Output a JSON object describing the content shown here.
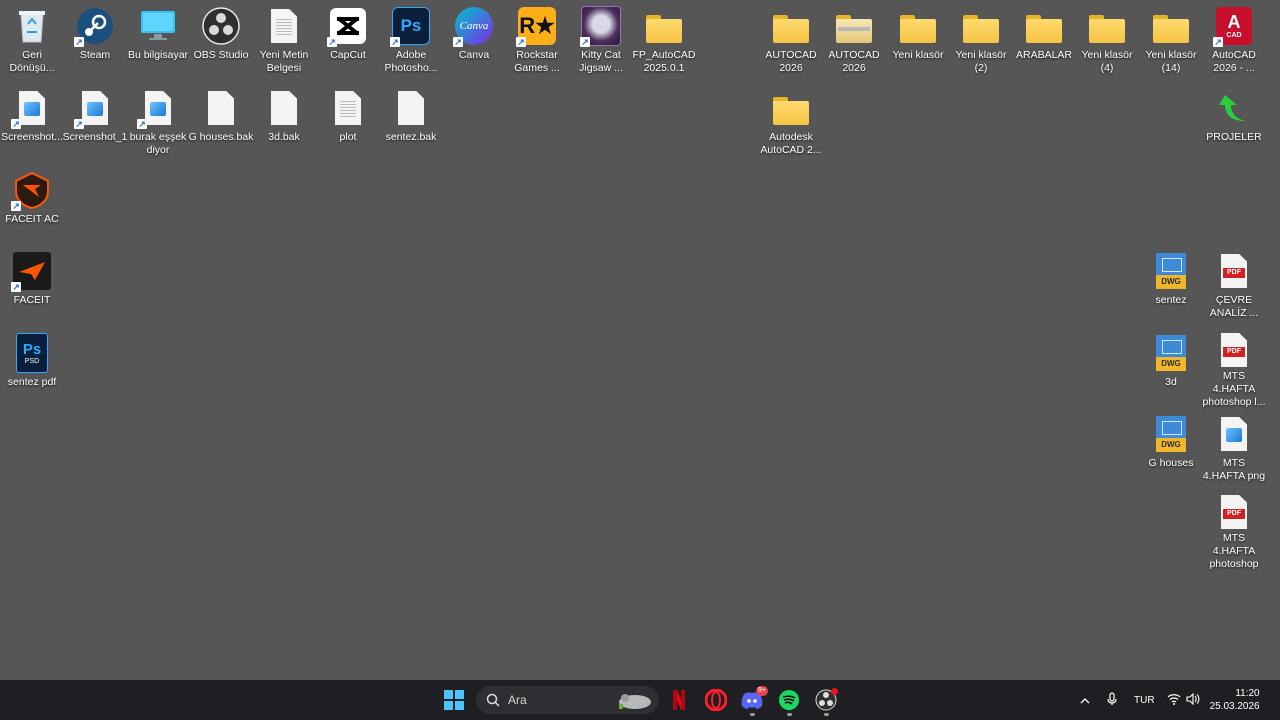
{
  "desktop": {
    "icons": [
      {
        "label": "Geri Dönüşü...",
        "icon": "recycle-bin-icon"
      },
      {
        "label": "Steam",
        "icon": "steam-icon"
      },
      {
        "label": "Bu bilgisayar",
        "icon": "computer-icon"
      },
      {
        "label": "OBS Studio",
        "icon": "obs-icon"
      },
      {
        "label": "Yeni Metin Belgesi",
        "icon": "text-file-icon"
      },
      {
        "label": "CapCut",
        "icon": "capcut-icon"
      },
      {
        "label": "Adobe Photosho...",
        "icon": "photoshop-icon"
      },
      {
        "label": "Canva",
        "icon": "canva-icon"
      },
      {
        "label": "Rockstar Games ...",
        "icon": "rockstar-icon"
      },
      {
        "label": "Kitty Cat Jigsaw ...",
        "icon": "kitty-cat-icon"
      },
      {
        "label": "FP_AutoCAD 2025.0.1",
        "icon": "folder-icon"
      },
      {
        "label": "AUTOCAD 2026",
        "icon": "folder-icon"
      },
      {
        "label": "AUTOCAD 2026",
        "icon": "folder-zip-icon"
      },
      {
        "label": "Yeni klasör",
        "icon": "folder-icon"
      },
      {
        "label": "Yeni klasör (2)",
        "icon": "folder-icon"
      },
      {
        "label": "ARABALAR",
        "icon": "folder-icon"
      },
      {
        "label": "Yeni klasör (4)",
        "icon": "folder-icon"
      },
      {
        "label": "Yeni klasör (14)",
        "icon": "folder-icon"
      },
      {
        "label": "AutoCAD 2026 - ...",
        "icon": "autocad-icon"
      },
      {
        "label": "Screenshot...",
        "icon": "image-file-icon"
      },
      {
        "label": "Screenshot_1",
        "icon": "image-file-icon"
      },
      {
        "label": "burak eşşek diyor",
        "icon": "image-file-icon"
      },
      {
        "label": "G houses.bak",
        "icon": "file-icon"
      },
      {
        "label": "3d.bak",
        "icon": "file-icon"
      },
      {
        "label": "plot",
        "icon": "text-file-icon"
      },
      {
        "label": "sentez.bak",
        "icon": "file-icon"
      },
      {
        "label": "Autodesk AutoCAD 2...",
        "icon": "folder-icon"
      },
      {
        "label": "PROJELER",
        "icon": "green-arrow-icon"
      },
      {
        "label": "FACEIT AC",
        "icon": "faceit-ac-icon"
      },
      {
        "label": "FACEIT",
        "icon": "faceit-icon"
      },
      {
        "label": "sentez pdf",
        "icon": "psd-icon"
      },
      {
        "label": "sentez",
        "icon": "dwg-icon"
      },
      {
        "label": "ÇEVRE ANALİZ ...",
        "icon": "pdf-icon"
      },
      {
        "label": "3d",
        "icon": "dwg-icon"
      },
      {
        "label": "MTS 4.HAFTA photoshop l...",
        "icon": "pdf-icon"
      },
      {
        "label": "G houses",
        "icon": "dwg-icon"
      },
      {
        "label": "MTS 4.HAFTA png",
        "icon": "image-file-icon"
      },
      {
        "label": "MTS 4.HAFTA photoshop",
        "icon": "pdf-icon"
      }
    ]
  },
  "badges": {
    "psd": "PSD",
    "ps": "Ps",
    "canva": "Canva",
    "dwg": "DWG",
    "pdf": "PDF",
    "cad_letter": "A",
    "cad_text": "CAD",
    "discord_badge": "9+"
  },
  "taskbar": {
    "search_placeholder": "Ara",
    "language": "TUR",
    "time": "11:20",
    "date": "25.03.2026"
  },
  "colors": {
    "desktop_bg": "#575656",
    "taskbar_bg": "#1e1f22",
    "folder": "#f5c344",
    "accent_blue": "#3d8ad8"
  }
}
